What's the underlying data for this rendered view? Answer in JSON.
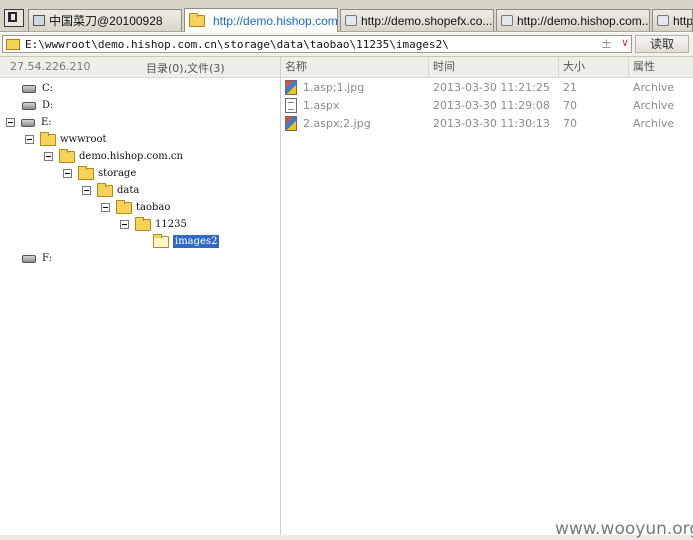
{
  "tabs": [
    {
      "label": "中国菜刀@20100928",
      "icon": "window-icon",
      "active": false
    },
    {
      "label": "http://demo.hishop.com....",
      "icon": "folder-icon",
      "active": true
    },
    {
      "label": "http://demo.shopefx.co...",
      "icon": "webpage-icon",
      "active": false
    },
    {
      "label": "http://demo.hishop.com....",
      "icon": "webpage-icon",
      "active": false
    },
    {
      "label": "http",
      "icon": "webpage-icon",
      "active": false
    }
  ],
  "address": {
    "path": "E:\\wwwroot\\demo.hishop.com.cn\\storage\\data\\taobao\\11235\\images2\\",
    "plus": "±",
    "dropdown": "∨",
    "read_label": "读取"
  },
  "left_header": {
    "ip": "27.54.226.210",
    "counts": "目录(0),文件(3)"
  },
  "tree": [
    {
      "label": "C:",
      "type": "drive"
    },
    {
      "label": "D:",
      "type": "drive"
    },
    {
      "label": "E:",
      "type": "drive",
      "expanded": true
    },
    {
      "label": "wwwroot",
      "type": "folder",
      "expanded": true
    },
    {
      "label": "demo.hishop.com.cn",
      "type": "folder",
      "expanded": true
    },
    {
      "label": "storage",
      "type": "folder",
      "expanded": true
    },
    {
      "label": "data",
      "type": "folder",
      "expanded": true
    },
    {
      "label": "taobao",
      "type": "folder",
      "expanded": true
    },
    {
      "label": "11235",
      "type": "folder",
      "expanded": true
    },
    {
      "label": "images2",
      "type": "folder",
      "selected": true
    },
    {
      "label": "F:",
      "type": "drive"
    }
  ],
  "columns": {
    "name": "名称",
    "time": "时间",
    "size": "大小",
    "attr": "属性"
  },
  "files": [
    {
      "name": "1.asp;1.jpg",
      "time": "2013-03-30 11:21:25",
      "size": "21",
      "attr": "Archive",
      "icon": "image-file-icon"
    },
    {
      "name": "1.aspx",
      "time": "2013-03-30 11:29:08",
      "size": "70",
      "attr": "Archive",
      "icon": "text-file-icon"
    },
    {
      "name": "2.aspx;2.jpg",
      "time": "2013-03-30 11:30:13",
      "size": "70",
      "attr": "Archive",
      "icon": "image-file-icon"
    }
  ],
  "watermark": "www.wooyun.org",
  "colors": {
    "selection": "#316ac5",
    "folder": "#f6d25a",
    "active_tab_text": "#1a6ac9"
  }
}
